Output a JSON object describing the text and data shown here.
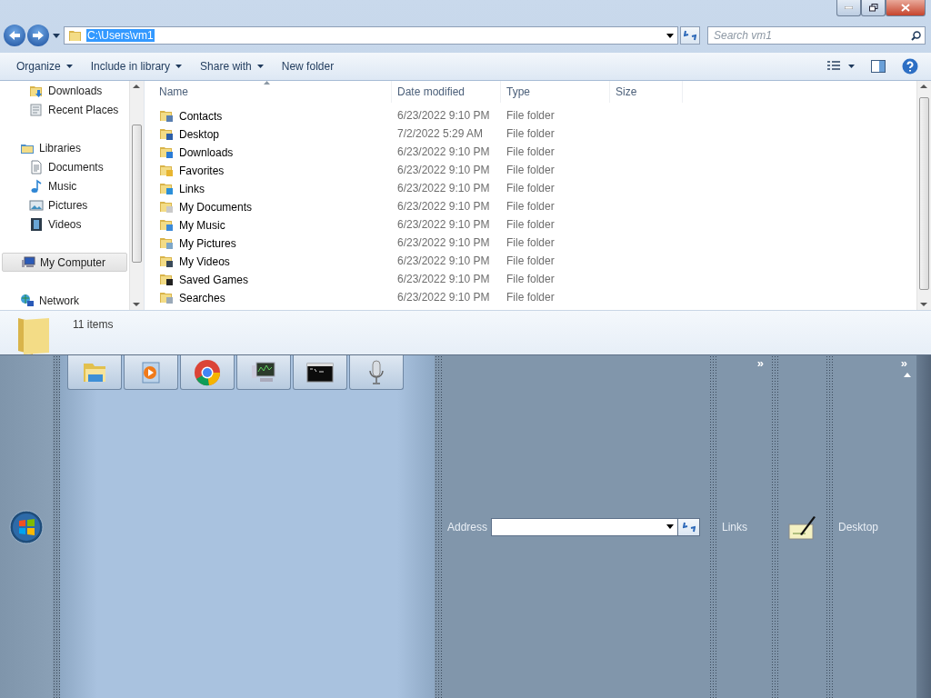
{
  "address_bar": {
    "path": "C:\\Users\\vm1",
    "path_selected": true
  },
  "search": {
    "placeholder": "Search vm1"
  },
  "toolbar": {
    "menus": [
      {
        "label": "Organize",
        "dropdown": true
      },
      {
        "label": "Include in library",
        "dropdown": true
      },
      {
        "label": "Share with",
        "dropdown": true
      },
      {
        "label": "New folder",
        "dropdown": false
      }
    ]
  },
  "nav_pane": {
    "favorites": [
      {
        "label": "Downloads",
        "kind": "downloads",
        "selected": false
      },
      {
        "label": "Recent Places",
        "kind": "recent",
        "selected": false
      }
    ],
    "tree": [
      {
        "label": "Libraries",
        "kind": "libraries",
        "selected": false,
        "children": [
          {
            "label": "Documents",
            "kind": "documents",
            "selected": false
          },
          {
            "label": "Music",
            "kind": "music",
            "selected": false
          },
          {
            "label": "Pictures",
            "kind": "pictures",
            "selected": false
          },
          {
            "label": "Videos",
            "kind": "videos",
            "selected": false
          }
        ]
      },
      {
        "label": "My Computer",
        "kind": "computer",
        "selected": true
      },
      {
        "label": "Network",
        "kind": "network",
        "selected": false
      }
    ]
  },
  "file_list": {
    "columns": [
      {
        "label": "Name",
        "sorted": true
      },
      {
        "label": "Date modified",
        "sorted": false
      },
      {
        "label": "Type",
        "sorted": false
      },
      {
        "label": "Size",
        "sorted": false
      }
    ],
    "rows": [
      {
        "name": "Contacts",
        "kind": "contacts",
        "date": "6/23/2022 9:10 PM",
        "type": "File folder"
      },
      {
        "name": "Desktop",
        "kind": "desktop",
        "date": "7/2/2022 5:29 AM",
        "type": "File folder"
      },
      {
        "name": "Downloads",
        "kind": "downloads",
        "date": "6/23/2022 9:10 PM",
        "type": "File folder"
      },
      {
        "name": "Favorites",
        "kind": "favorites",
        "date": "6/23/2022 9:10 PM",
        "type": "File folder"
      },
      {
        "name": "Links",
        "kind": "links",
        "date": "6/23/2022 9:10 PM",
        "type": "File folder"
      },
      {
        "name": "My Documents",
        "kind": "documents",
        "date": "6/23/2022 9:10 PM",
        "type": "File folder"
      },
      {
        "name": "My Music",
        "kind": "music",
        "date": "6/23/2022 9:10 PM",
        "type": "File folder"
      },
      {
        "name": "My Pictures",
        "kind": "pictures",
        "date": "6/23/2022 9:10 PM",
        "type": "File folder"
      },
      {
        "name": "My Videos",
        "kind": "videos",
        "date": "6/23/2022 9:10 PM",
        "type": "File folder"
      },
      {
        "name": "Saved Games",
        "kind": "games",
        "date": "6/23/2022 9:10 PM",
        "type": "File folder"
      },
      {
        "name": "Searches",
        "kind": "searches",
        "date": "6/23/2022 9:10 PM",
        "type": "File folder"
      }
    ]
  },
  "details_pane": {
    "summary": "11 items"
  },
  "taskbar": {
    "quick_launch": [
      {
        "kind": "explorer"
      },
      {
        "kind": "media"
      },
      {
        "kind": "browser"
      },
      {
        "kind": "monitor"
      },
      {
        "kind": "terminal"
      },
      {
        "kind": "microphone"
      }
    ],
    "address_toolbar": {
      "label": "Address"
    },
    "links_toolbar": {
      "label": "Links",
      "overflow": "»"
    },
    "desktop_toolbar": {
      "label": "Desktop",
      "overflow": "»"
    }
  }
}
